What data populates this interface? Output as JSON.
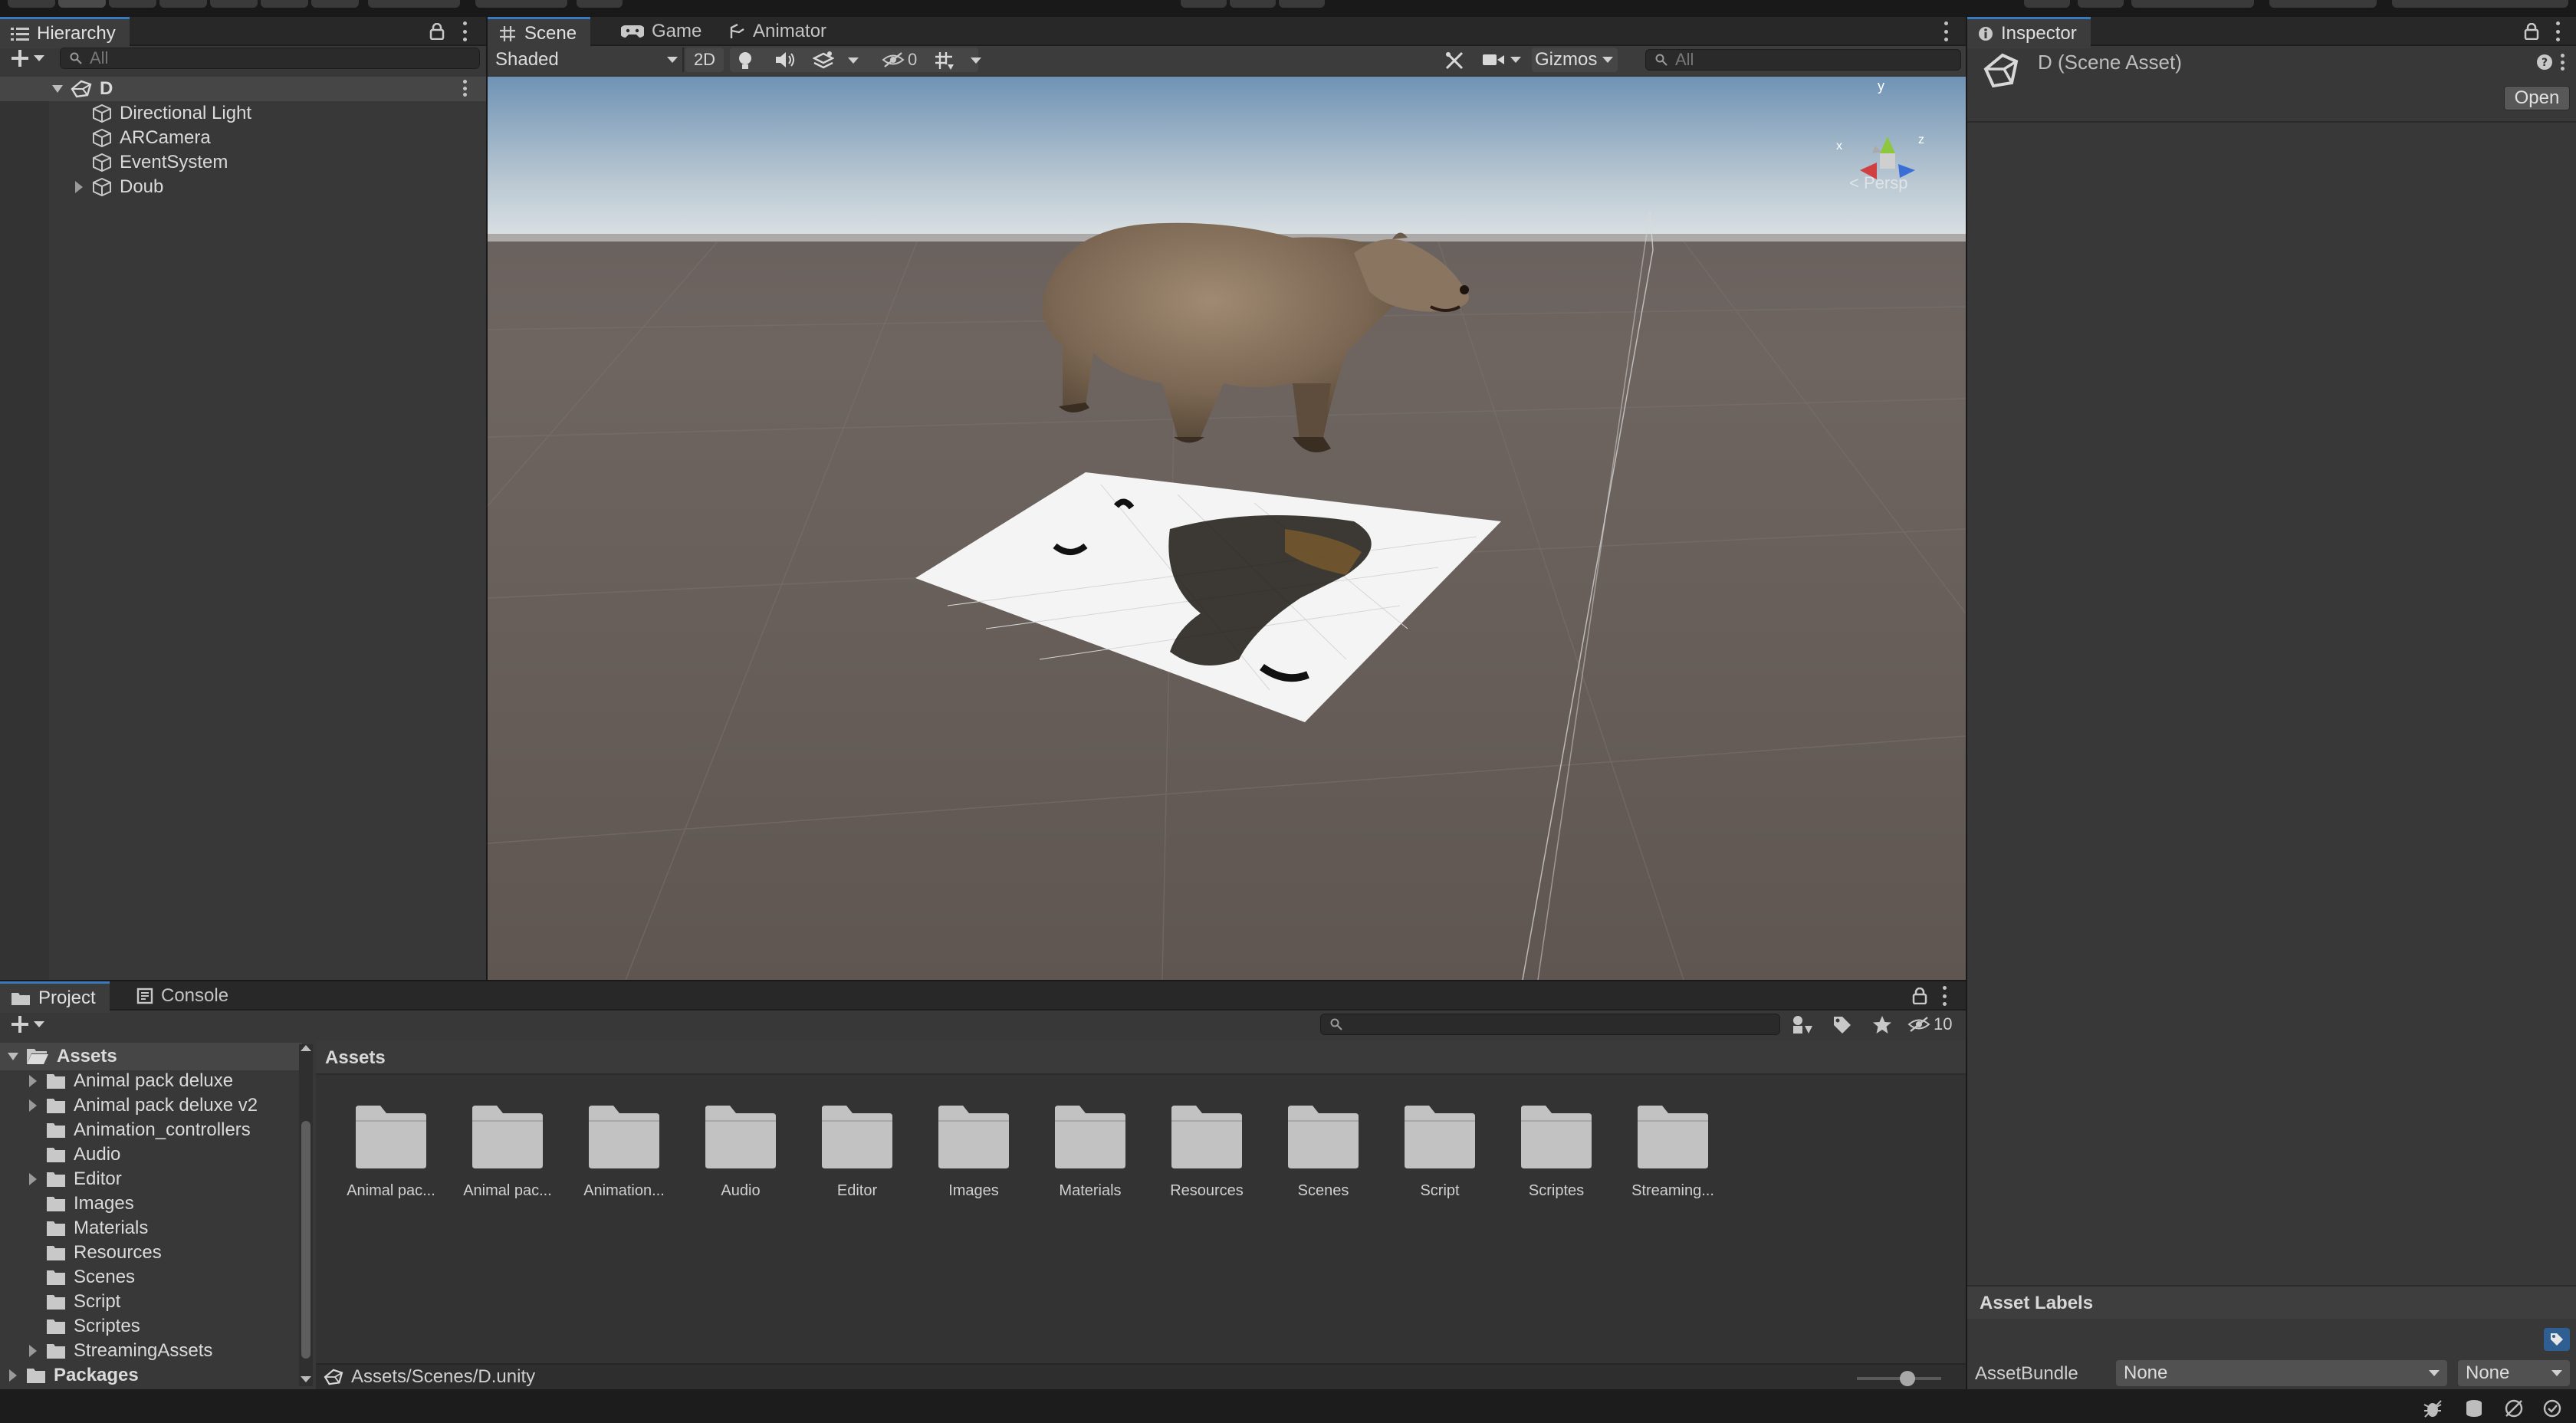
{
  "hierarchy": {
    "tab": "Hierarchy",
    "search_placeholder": "All",
    "scene": "D",
    "items": [
      "Directional Light",
      "ARCamera",
      "EventSystem",
      "Doub"
    ]
  },
  "scene_view": {
    "tabs": [
      "Scene",
      "Game",
      "Animator"
    ],
    "shading": "Shaded",
    "mode_2d": "2D",
    "hidden_count": "0",
    "gizmos": "Gizmos",
    "search_placeholder": "All",
    "projection": "< Persp",
    "gizmo_axes": {
      "x": "x",
      "y": "y",
      "z": "z"
    }
  },
  "inspector": {
    "tab": "Inspector",
    "title": "D (Scene Asset)",
    "open_button": "Open",
    "asset_labels": "Asset Labels",
    "asset_bundle_label": "AssetBundle",
    "asset_bundle_value": "None",
    "asset_bundle_variant": "None"
  },
  "project": {
    "tabs": [
      "Project",
      "Console"
    ],
    "hidden_count": "10",
    "breadcrumb": "Assets",
    "tree_root": "Assets",
    "tree": [
      {
        "label": "Animal pack deluxe",
        "expandable": true
      },
      {
        "label": "Animal pack deluxe v2",
        "expandable": true
      },
      {
        "label": "Animation_controllers",
        "expandable": false
      },
      {
        "label": "Audio",
        "expandable": false
      },
      {
        "label": "Editor",
        "expandable": true
      },
      {
        "label": "Images",
        "expandable": false
      },
      {
        "label": "Materials",
        "expandable": false
      },
      {
        "label": "Resources",
        "expandable": false
      },
      {
        "label": "Scenes",
        "expandable": false
      },
      {
        "label": "Script",
        "expandable": false
      },
      {
        "label": "Scriptes",
        "expandable": false
      },
      {
        "label": "StreamingAssets",
        "expandable": true
      }
    ],
    "packages": "Packages",
    "grid": [
      "Animal pac...",
      "Animal pac...",
      "Animation...",
      "Audio",
      "Editor",
      "Images",
      "Materials",
      "Resources",
      "Scenes",
      "Script",
      "Scriptes",
      "Streaming..."
    ],
    "path": "Assets/Scenes/D.unity",
    "thumbnail_size": 0.6
  },
  "colors": {
    "accent": "#3a79bb",
    "panel": "#383838",
    "background": "#191919"
  }
}
